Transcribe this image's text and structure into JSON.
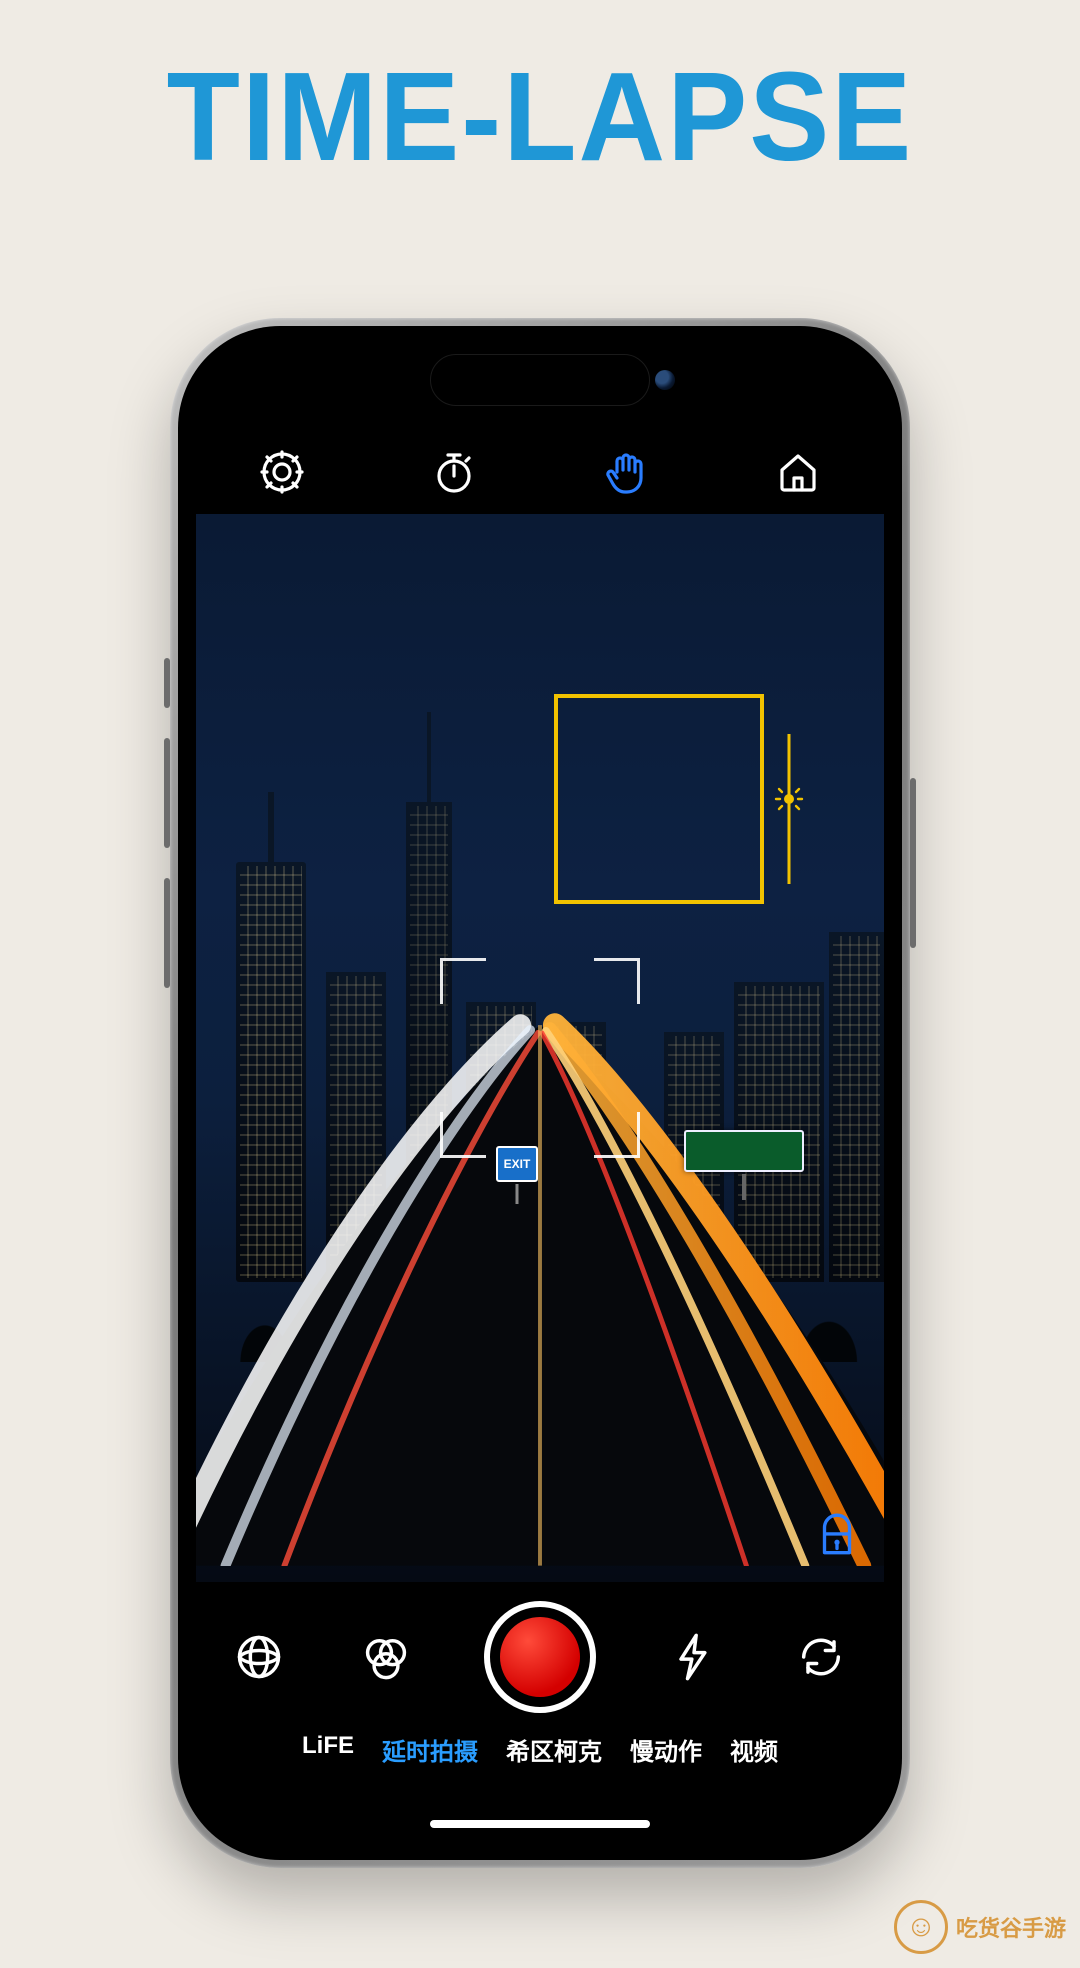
{
  "hero": {
    "title": "TIME-LAPSE"
  },
  "topbar": {
    "settings": "settings",
    "timer": "timer",
    "gesture": "gesture",
    "home": "home"
  },
  "viewfinder": {
    "exit_label": "EXIT"
  },
  "controls": {
    "gallery": "gallery",
    "filters": "filters",
    "record": "record",
    "flash": "flash",
    "switch": "switch-camera"
  },
  "modes": {
    "items": [
      "LiFE",
      "延时拍摄",
      "希区柯克",
      "慢动作",
      "视频"
    ],
    "active_index": 1
  },
  "page_watermark": {
    "label": "吃货谷手游"
  }
}
